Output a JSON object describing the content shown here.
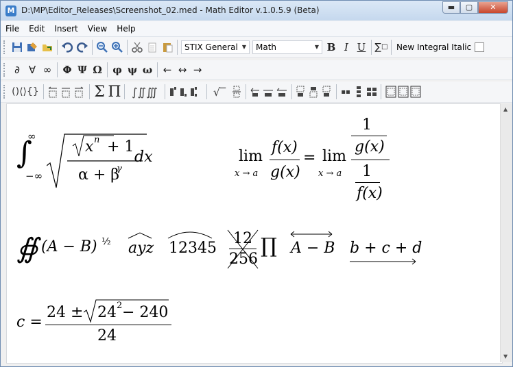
{
  "window": {
    "title": "D:\\MP\\Editor_Releases\\Screenshot_02.med - Math Editor v.1.0.5.9 (Beta)",
    "app_icon": "M",
    "buttons": {
      "minimize": "▬",
      "maximize": "▢",
      "close": "✕"
    }
  },
  "menu": [
    "File",
    "Edit",
    "Insert",
    "View",
    "Help"
  ],
  "toolbar": {
    "font": "STIX General",
    "style": "Math",
    "bold": "B",
    "italic": "I",
    "underline": "U",
    "integral_italic_label": "New Integral Italic"
  },
  "symbols_row": [
    "∂",
    "∀",
    "∞",
    "Φ",
    "Ψ",
    "Ω",
    "φ",
    "ψ",
    "ω",
    "←",
    "↔",
    "→"
  ],
  "equations": {
    "eq1": {
      "int_sym": "∫",
      "upper": "∞",
      "lower": "−∞",
      "num": "x",
      "exp": "n",
      "plus": "+ 1",
      "den": "α + β",
      "den_exp": "γ",
      "dx": "dx"
    },
    "eq2": {
      "lim": "lim",
      "sub": "x → a",
      "num": "f(x)",
      "den": "g(x)",
      "eq": "=",
      "one": "1"
    },
    "eq3": {
      "oint": "∯",
      "base": "(A − B)",
      "exp": "½",
      "hat1": "ayz",
      "hat2": "12345",
      "frac_num": "12",
      "frac_den": "256",
      "prod": "∏",
      "arrow_top": "A − B",
      "arrow_bottom": "b + c + d"
    },
    "eq4": {
      "lhs": "c =",
      "num_a": "24 ±",
      "radicand": "24",
      "rad_exp": "2",
      "minus": " − 240",
      "den": "24"
    }
  }
}
